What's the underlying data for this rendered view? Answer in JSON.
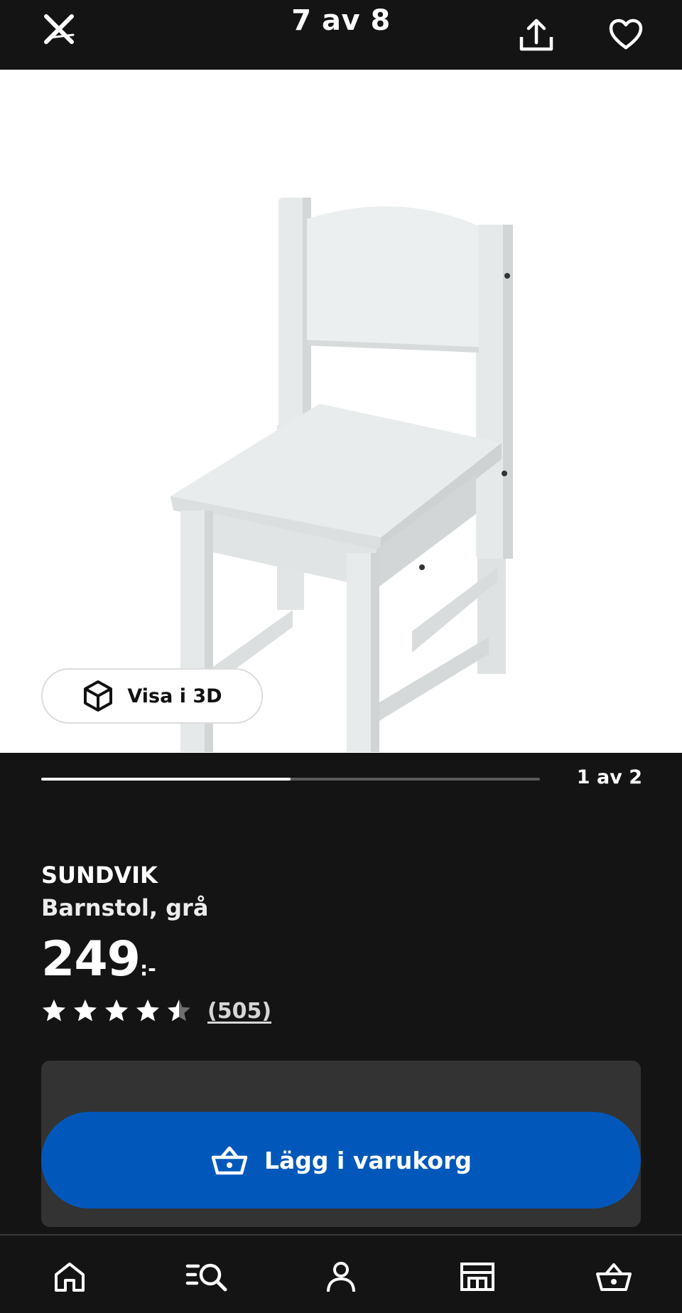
{
  "header": {
    "counter": "7 av 8"
  },
  "gallery": {
    "view_3d_label": "Visa i 3D",
    "progress_text": "1 av 2",
    "progress_fraction": 0.5
  },
  "product": {
    "brand": "SUNDVIK",
    "description": "Barnstol, grå",
    "price_integer": "249",
    "price_suffix": ":-",
    "rating_value": 4.5,
    "review_count": "(505)"
  },
  "cart": {
    "button_label": "Lägg i varukorg"
  },
  "bottom_nav": {
    "items": [
      "home-icon",
      "search-icon",
      "profile-icon",
      "store-icon",
      "cart-icon"
    ]
  },
  "colors": {
    "background": "#141414",
    "accent_blue": "#0158ba",
    "panel": "#333333"
  }
}
